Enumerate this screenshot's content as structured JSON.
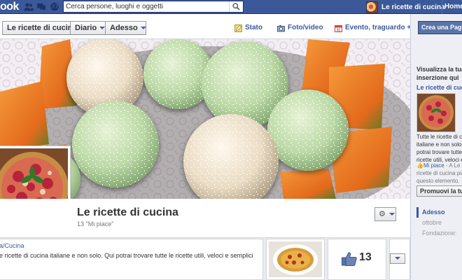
{
  "topbar": {
    "logo": "ook",
    "search_placeholder": "Cerca persone, luoghi e oggetti",
    "profile_name": "Le ricette di cucina",
    "home": "Home"
  },
  "nav": {
    "page_name": "Le ricette di cucina",
    "diary": "Diario",
    "now": "Adesso"
  },
  "composer": {
    "status": "Stato",
    "photo": "Foto/video",
    "event": "Evento, traguardo +"
  },
  "page": {
    "name": "Le ricette di cucina",
    "likes": "13 \"Mi piace\""
  },
  "about": {
    "category": "a/Cucina",
    "description": "e ricette di cucina italiane e non solo. Qui potrai trovare tutte le ricette utili, veloci e semplici"
  },
  "likes_count": "13",
  "sidebar": {
    "create_page": "Crea una Pagina",
    "ad_heading": "Visualizza la tua inserzione qui",
    "ad_title": "Le ricette di cucina",
    "ad_body": "Tutte le ricette di c italiane e non solo. potrai trovare tutte ricette utili, veloci e",
    "ad_like_link": "Mi piace",
    "ad_like_text": " · A Le ricette di cucina pia questo elemento.",
    "promote": "Promuovi la tu",
    "scrubber": [
      "Adesso",
      "ottobre",
      "Fondazione:"
    ]
  },
  "colors": {
    "brand": "#3b5998",
    "link": "#3b5998",
    "sidebar_bg": "#edeff4"
  }
}
